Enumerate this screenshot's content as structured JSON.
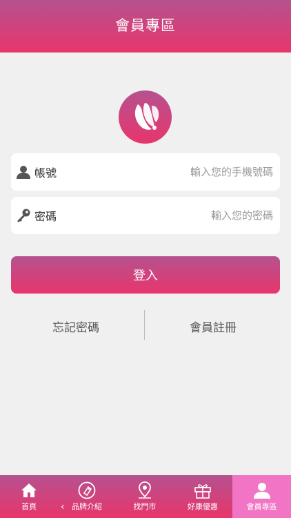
{
  "header": {
    "title": "會員專區"
  },
  "login_form": {
    "account": {
      "label": "帳號",
      "placeholder": "輸入您的手機號碼"
    },
    "password": {
      "label": "密碼",
      "placeholder": "輸入您的密碼"
    },
    "submit_label": "登入"
  },
  "links": {
    "forgot_password": "忘記密碼",
    "register": "會員註冊"
  },
  "tabbar": {
    "items": [
      {
        "label": "首頁",
        "icon": "home-icon"
      },
      {
        "label": "品牌介紹",
        "icon": "brand-tag-icon"
      },
      {
        "label": "找門市",
        "icon": "store-locator-icon"
      },
      {
        "label": "好康優惠",
        "icon": "gift-icon"
      },
      {
        "label": "會員專區",
        "icon": "member-icon"
      }
    ],
    "active_index": 4
  },
  "colors": {
    "primary_top": "#b5528f",
    "primary_bottom": "#e8356c",
    "active_tab": "#f274c4",
    "background": "#f0f0f0"
  }
}
